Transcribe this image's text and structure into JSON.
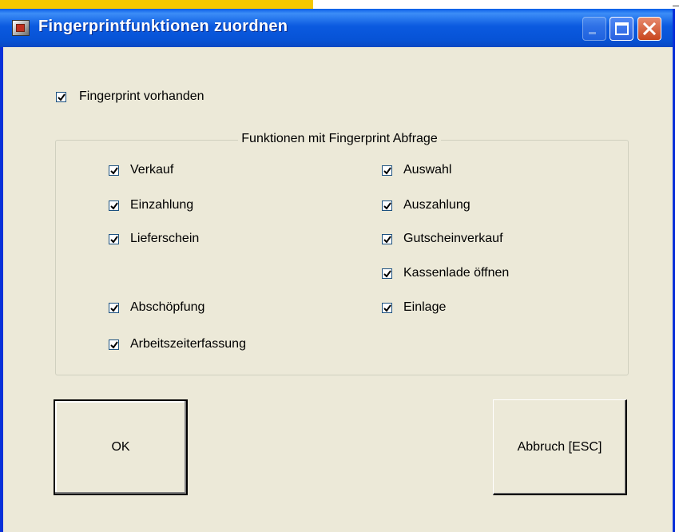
{
  "window": {
    "title": "Fingerprintfunktionen zuordnen"
  },
  "main_checkbox": {
    "label": "Fingerprint vorhanden",
    "checked": true
  },
  "group": {
    "title": "Funktionen mit Fingerprint Abfrage",
    "left": [
      {
        "label": "Verkauf",
        "checked": true
      },
      {
        "label": "Einzahlung",
        "checked": true
      },
      {
        "label": "Lieferschein",
        "checked": true
      },
      {
        "label": "Abschöpfung",
        "checked": true
      },
      {
        "label": "Arbeitszeiterfassung",
        "checked": true
      }
    ],
    "right": [
      {
        "label": "Auswahl",
        "checked": true
      },
      {
        "label": "Auszahlung",
        "checked": true
      },
      {
        "label": "Gutscheinverkauf",
        "checked": true
      },
      {
        "label": "Kassenlade öffnen",
        "checked": true
      },
      {
        "label": "Einlage",
        "checked": true
      }
    ]
  },
  "buttons": {
    "ok": "OK",
    "cancel": "Abbruch [ESC]"
  },
  "colors": {
    "titlebar": "#0a5ee8",
    "window_bg": "#ece9d8",
    "accent": "#f5c800"
  }
}
